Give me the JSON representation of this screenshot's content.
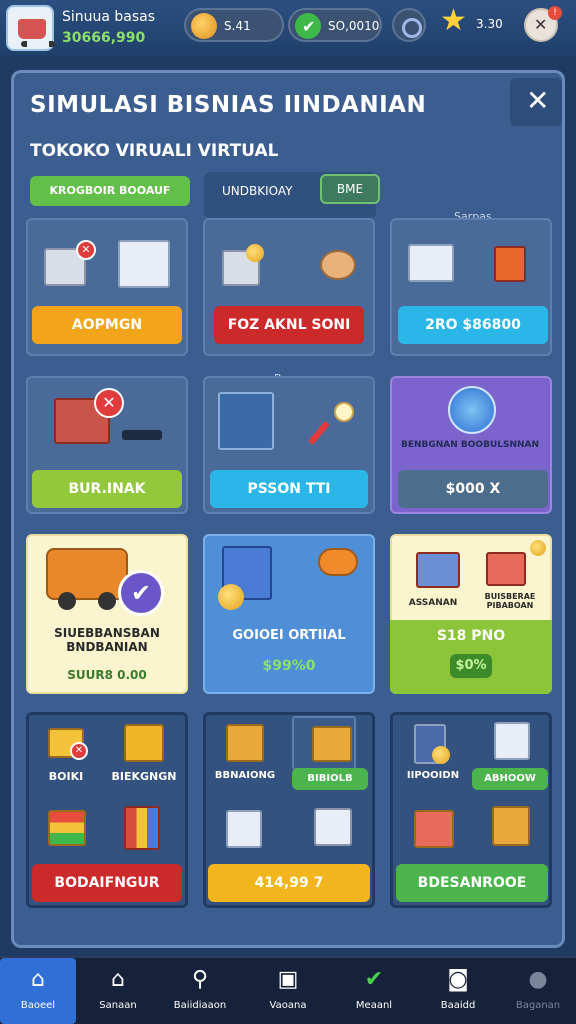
{
  "header": {
    "app_name": "Sinuua basas",
    "app_money": "30666,990",
    "currency_a": "S.41",
    "currency_b": "SO,0010",
    "stars": "3.30"
  },
  "panel": {
    "title": "SIMULASI BISNIAS IINDANIAN",
    "subtitle": "TOKOKO VIRUALI VIRTUAL",
    "tab_green": "KROGBOIR BOOAUF",
    "tab_header": "UNDBKIOAY",
    "tab_badge": "BME",
    "label_sarpas": "Sarpas",
    "label_bacau": "Bacau"
  },
  "cards": {
    "r1c1_btn": "AOPMGN",
    "r1c2_btn": "FOZ AKNL SONI",
    "r1c3_btn": "2RO $86800",
    "r2c1_btn": "BUR.INAK",
    "r2c2_btn": "PSSON TTI",
    "r2c3_label": "BENBGNAN BOOBULSNNAN",
    "r2c3_btn": "$000 X",
    "r3c1_title": "SIUEBBANSBAN BNDBANIAN",
    "r3c1_value": "SUUR8 0.00",
    "r3c2_title": "GOIOEI ORTIIAL",
    "r3c2_value": "$99%0",
    "r3c3_left": "ASSANAN",
    "r3c3_right": "BUISBERAE PIBABOAN",
    "r3c3_title": "S18 PNO",
    "r3c3_value": "$0%",
    "r4c1_a": "BOIKI",
    "r4c1_b": "BIEKGNGN",
    "r4c1_btn": "BODAIFNGUR",
    "r4c2_a": "BBNAIONG",
    "r4c2_b": "BIBIOLB",
    "r4c2_btn": "414,99 7",
    "r4c3_a": "IIPOOIDN",
    "r4c3_b": "ABHOOW",
    "r4c3_btn": "BDESANROOE"
  },
  "nav": [
    {
      "label": "Baoeel",
      "icon": "home-icon"
    },
    {
      "label": "Sanaan",
      "icon": "store-icon"
    },
    {
      "label": "Baiidiaaon",
      "icon": "bag-icon"
    },
    {
      "label": "Vaoana",
      "icon": "clipboard-icon"
    },
    {
      "label": "Meaanl",
      "icon": "check-icon"
    },
    {
      "label": "Baaidd",
      "icon": "camera-icon"
    },
    {
      "label": "Baganan",
      "icon": "user-icon"
    }
  ],
  "colors": {
    "panel": "#3b5d8f",
    "accent_green": "#4cb44c",
    "accent_orange": "#f2a51b",
    "accent_red": "#cc2a2a",
    "nav_active": "#2f6fd6"
  }
}
